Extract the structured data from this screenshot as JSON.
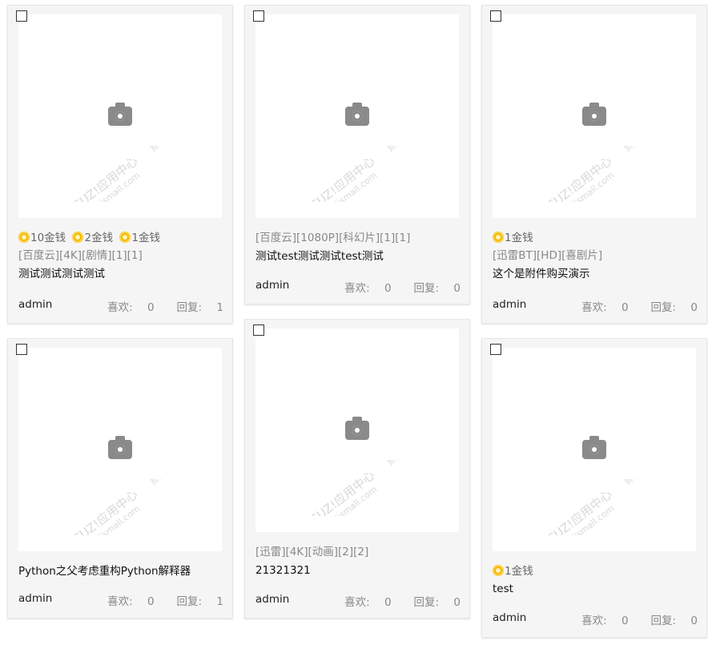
{
  "labels": {
    "likes": "喜欢:",
    "replies": "回复:"
  },
  "cards": [
    {
      "prices": [
        "10金钱",
        "2金钱",
        "1金钱"
      ],
      "tags": "[百度云][4K][剧情][1][1]",
      "title": "测试测试测试测试",
      "author": "admin",
      "likes": "0",
      "replies": "1"
    },
    {
      "tags": "[百度云][1080P][科幻片][1][1]",
      "title": "测试test测试测试test测试",
      "author": "admin",
      "likes": "0",
      "replies": "0"
    },
    {
      "prices": [
        "1金钱"
      ],
      "tags": "[迅雷BT][HD][喜剧片]",
      "title": "这个是附件购买演示",
      "author": "admin",
      "likes": "0",
      "replies": "0"
    },
    {
      "title": "Python之父考虑重构Python解释器",
      "author": "admin",
      "likes": "0",
      "replies": "1"
    },
    {
      "tags": "[迅雷][4K][动画][2][2]",
      "title": "21321321",
      "author": "admin",
      "likes": "0",
      "replies": "0"
    },
    {
      "prices": [
        "1金钱"
      ],
      "title": "test",
      "author": "admin",
      "likes": "0",
      "replies": "0"
    }
  ],
  "watermark": {
    "line1": "DISCUZ!应用中心",
    "line2": "addon.dismall.com",
    "brand": "贰道"
  }
}
